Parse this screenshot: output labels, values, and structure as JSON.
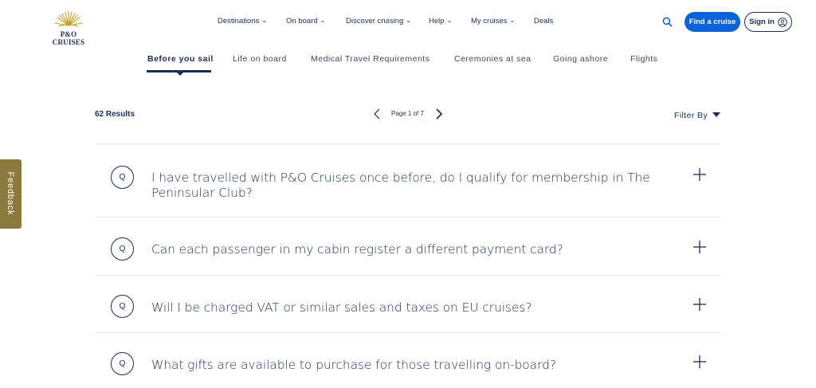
{
  "brand": {
    "name": "P&O CRUISES",
    "gold": "#c9a227",
    "navy": "#1a2d5a",
    "accent": "#0a63d9"
  },
  "nav": {
    "items": [
      {
        "label": "Destinations",
        "has_dropdown": true
      },
      {
        "label": "On board",
        "has_dropdown": true
      },
      {
        "label": "Discover cruising",
        "has_dropdown": true
      },
      {
        "label": "Help",
        "has_dropdown": true
      },
      {
        "label": "My cruises",
        "has_dropdown": true
      },
      {
        "label": "Deals",
        "has_dropdown": false
      }
    ],
    "search_icon": "search-icon",
    "find_cruise_label": "Find a cruise",
    "sign_in_label": "Sign in"
  },
  "subnav": {
    "tabs": [
      {
        "label": "Before you sail",
        "active": true
      },
      {
        "label": "Life on board",
        "active": false
      },
      {
        "label": "Medical Travel Requirements",
        "active": false
      },
      {
        "label": "Ceremonies at sea",
        "active": false
      },
      {
        "label": "Going ashore",
        "active": false
      },
      {
        "label": "Flights",
        "active": false
      }
    ]
  },
  "results": {
    "count_label": "62 Results",
    "page_label": "Page 1 of 7",
    "filter_label": "Filter By"
  },
  "faq": {
    "badge": "Q",
    "items": [
      {
        "question": "I have travelled with P&O Cruises once before, do I qualify for membership in The Peninsular Club?"
      },
      {
        "question": "Can each passenger in my cabin register a different payment card?"
      },
      {
        "question": "Will I be charged VAT or similar sales and taxes on EU cruises?"
      },
      {
        "question": "What gifts are available to purchase for those travelling on-board?"
      }
    ]
  },
  "feedback": {
    "label": "Feedback",
    "color": "#8b7a3e"
  }
}
